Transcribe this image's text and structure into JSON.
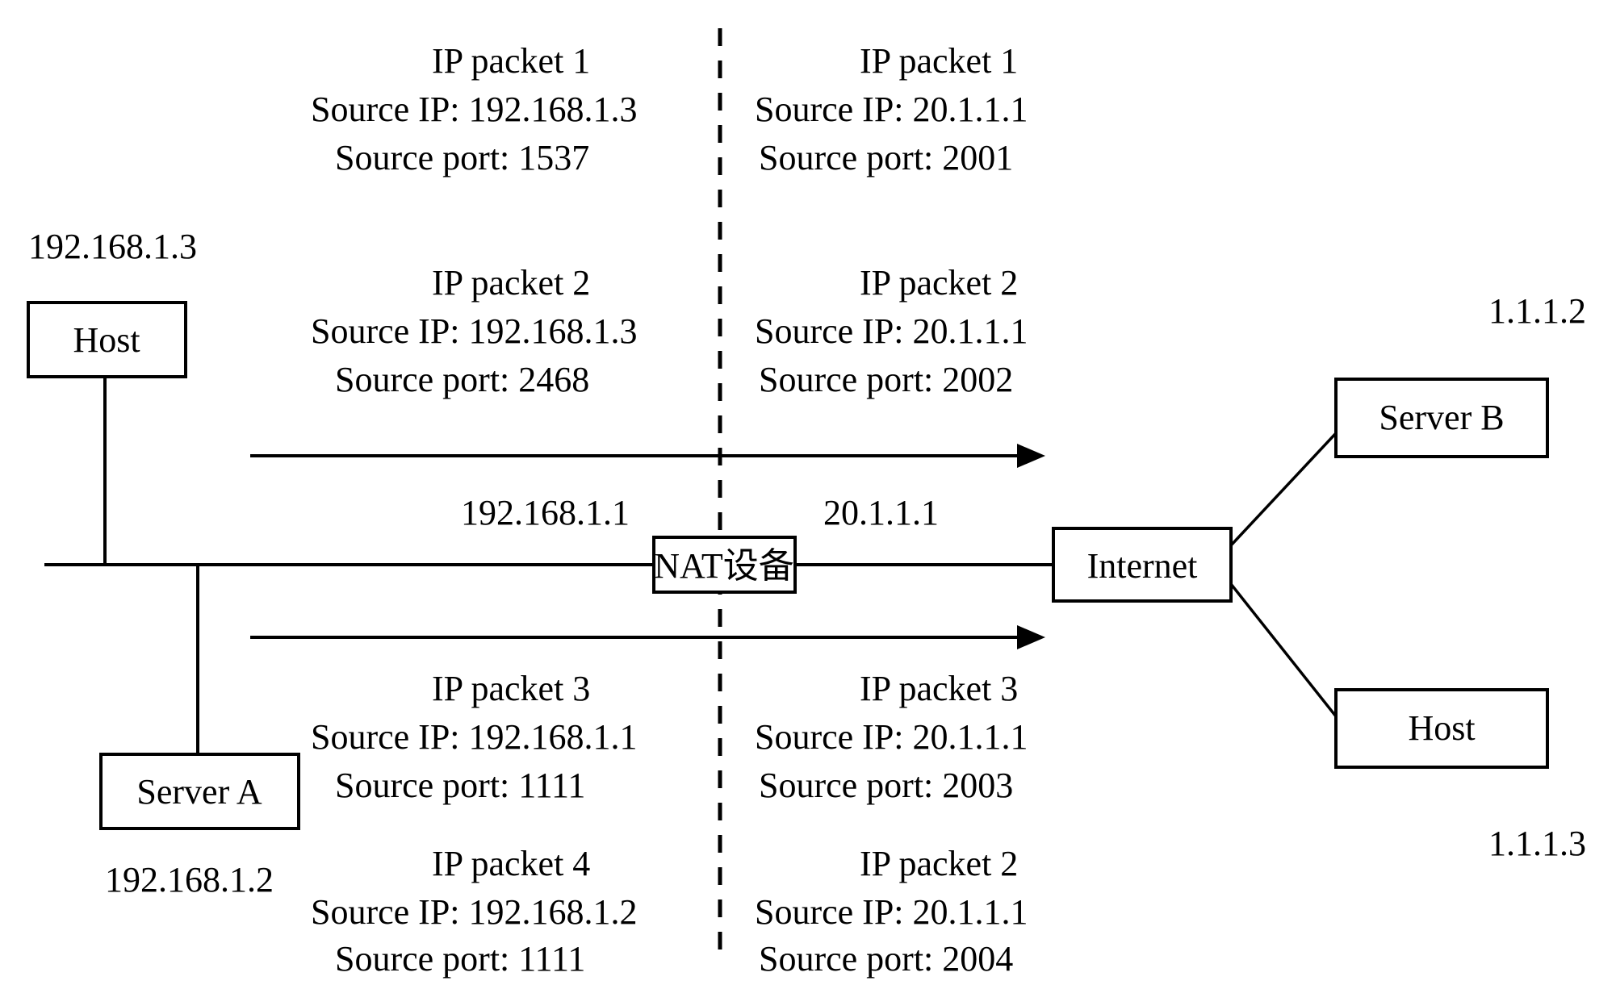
{
  "left": {
    "host_ip": "192.168.1.3",
    "host_label": "Host",
    "server_a_label": "Server A",
    "server_a_ip": "192.168.1.2",
    "nat_left_ip": "192.168.1.1"
  },
  "center": {
    "nat_label": "NAT设备"
  },
  "right": {
    "nat_right_ip": "20.1.1.1",
    "internet_label": "Internet",
    "server_b_label": "Server  B",
    "server_b_ip": "1.1.1.2",
    "host_label": "Host",
    "host_ip": "1.1.1.3"
  },
  "packets": {
    "p1_left": {
      "l1": "IP  packet  1",
      "l2": "Source  IP:   192.168.1.3",
      "l3": "Source  port:   1537"
    },
    "p1_right": {
      "l1": "IP  packet  1",
      "l2": "Source  IP:   20.1.1.1",
      "l3": "Source  port:   2001"
    },
    "p2_left": {
      "l1": "IP  packet  2",
      "l2": "Source  IP:   192.168.1.3",
      "l3": "Source  port:   2468"
    },
    "p2_right": {
      "l1": "IP  packet  2",
      "l2": "Source  IP:   20.1.1.1",
      "l3": "Source  port:   2002"
    },
    "p3_left": {
      "l1": "IP  packet  3",
      "l2": "Source  IP:   192.168.1.1",
      "l3": "Source  port:   1111"
    },
    "p3_right": {
      "l1": "IP  packet  3",
      "l2": "Source  IP:   20.1.1.1",
      "l3": "Source  port:   2003"
    },
    "p4_left": {
      "l1": "IP  packet  4",
      "l2": "Source  IP:  192.168.1.2",
      "l3": "Source  port:   1111"
    },
    "p4_right": {
      "l1": "IP  packet  2",
      "l2": "Source  IP:   20.1.1.1",
      "l3": "Source  port:   2004"
    }
  }
}
